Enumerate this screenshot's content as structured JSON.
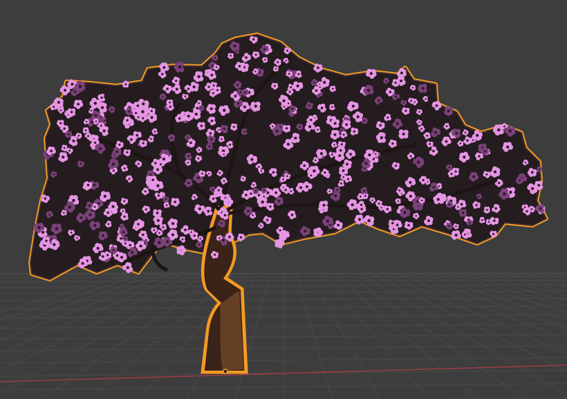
{
  "viewport": {
    "background": "#3d3d3d",
    "grid_color": "#4a4a4a",
    "x_axis_color": "#9b3c47",
    "y_axis_color": "#5e7a2b"
  },
  "object": {
    "type": "tree",
    "selected": true,
    "outline_color": "#f59a23",
    "trunk_color": "#3a2318",
    "trunk_highlight": "#8a5a33",
    "branch_color": "#1c1513",
    "blossom_color": "#e695e4",
    "blossom_shadow": "#7b4179",
    "origin_color": "#f59a23",
    "origin_icon": "origin-point-icon"
  }
}
